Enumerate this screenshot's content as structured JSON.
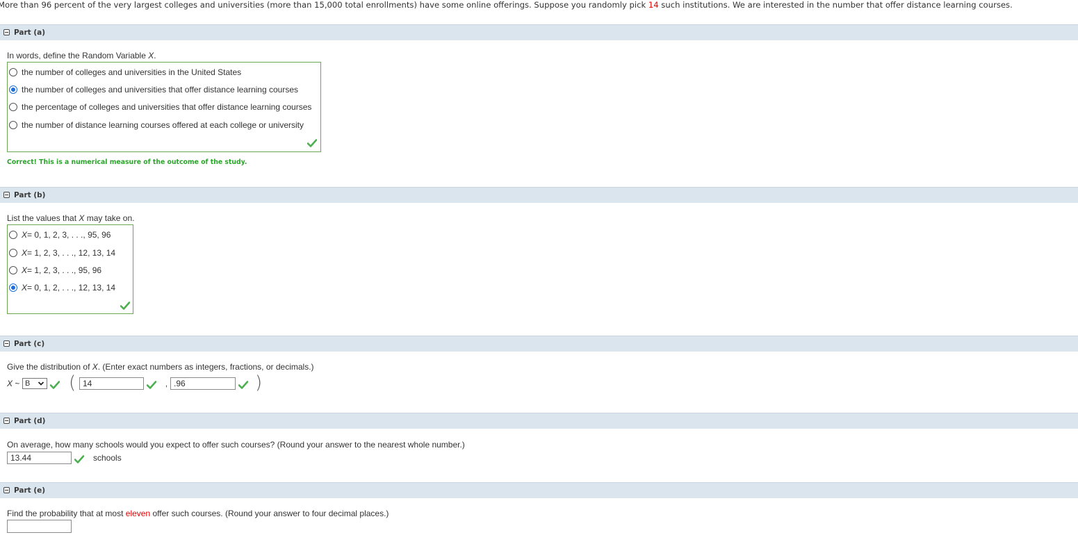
{
  "intro": {
    "before": "More than 96 percent of the very largest colleges and universities (more than 15,000 total enrollments) have some online offerings. Suppose you randomly pick ",
    "highlight": "14",
    "after": " such institutions. We are interested in the number that offer distance learning courses."
  },
  "parts": {
    "a": {
      "label": "Part (a)",
      "prompt_before": "In words, define the Random Variable ",
      "var": "X",
      "prompt_after": ".",
      "options": [
        "the number of colleges and universities in the United States",
        "the number of colleges and universities that offer distance learning courses",
        "the percentage of colleges and universities that offer distance learning courses",
        "the number of distance learning courses offered at each college or university"
      ],
      "selected": 1,
      "feedback": "Correct! This is a numerical measure of the outcome of the study."
    },
    "b": {
      "label": "Part (b)",
      "prompt_before": "List the values that ",
      "var": "X",
      "prompt_after": " may take on.",
      "options": [
        {
          "var": "X",
          "text": " = 0, 1, 2, 3, . . ., 95, 96"
        },
        {
          "var": "X",
          "text": " = 1, 2, 3, . . ., 12, 13, 14"
        },
        {
          "var": "X",
          "text": " = 1, 2, 3, . . ., 95, 96"
        },
        {
          "var": "X",
          "text": " = 0, 1, 2, . . ., 12, 13, 14"
        }
      ],
      "selected": 3
    },
    "c": {
      "label": "Part (c)",
      "prompt_before": "Give the distribution of ",
      "var": "X",
      "prompt_after": ". (Enter exact numbers as integers, fractions, or decimals.)",
      "dist_prefix": "~",
      "dist_select": "B",
      "n_value": "14",
      "comma": ",",
      "p_value": ".96"
    },
    "d": {
      "label": "Part (d)",
      "prompt": "On average, how many schools would you expect to offer such courses? (Round your answer to the nearest whole number.)",
      "answer": "13.44",
      "unit": "schools"
    },
    "e": {
      "label": "Part (e)",
      "prompt_before": "Find the probability that at most ",
      "highlight": "eleven",
      "prompt_after": " offer such courses. (Round your answer to four decimal places.)",
      "answer": ""
    }
  },
  "colors": {
    "header_bg": "#dbe5ee",
    "correct_green": "#2ba42b",
    "box_border": "#6aa84f",
    "highlight_red": "#e30000",
    "radio_selected": "#1e6fd9"
  }
}
